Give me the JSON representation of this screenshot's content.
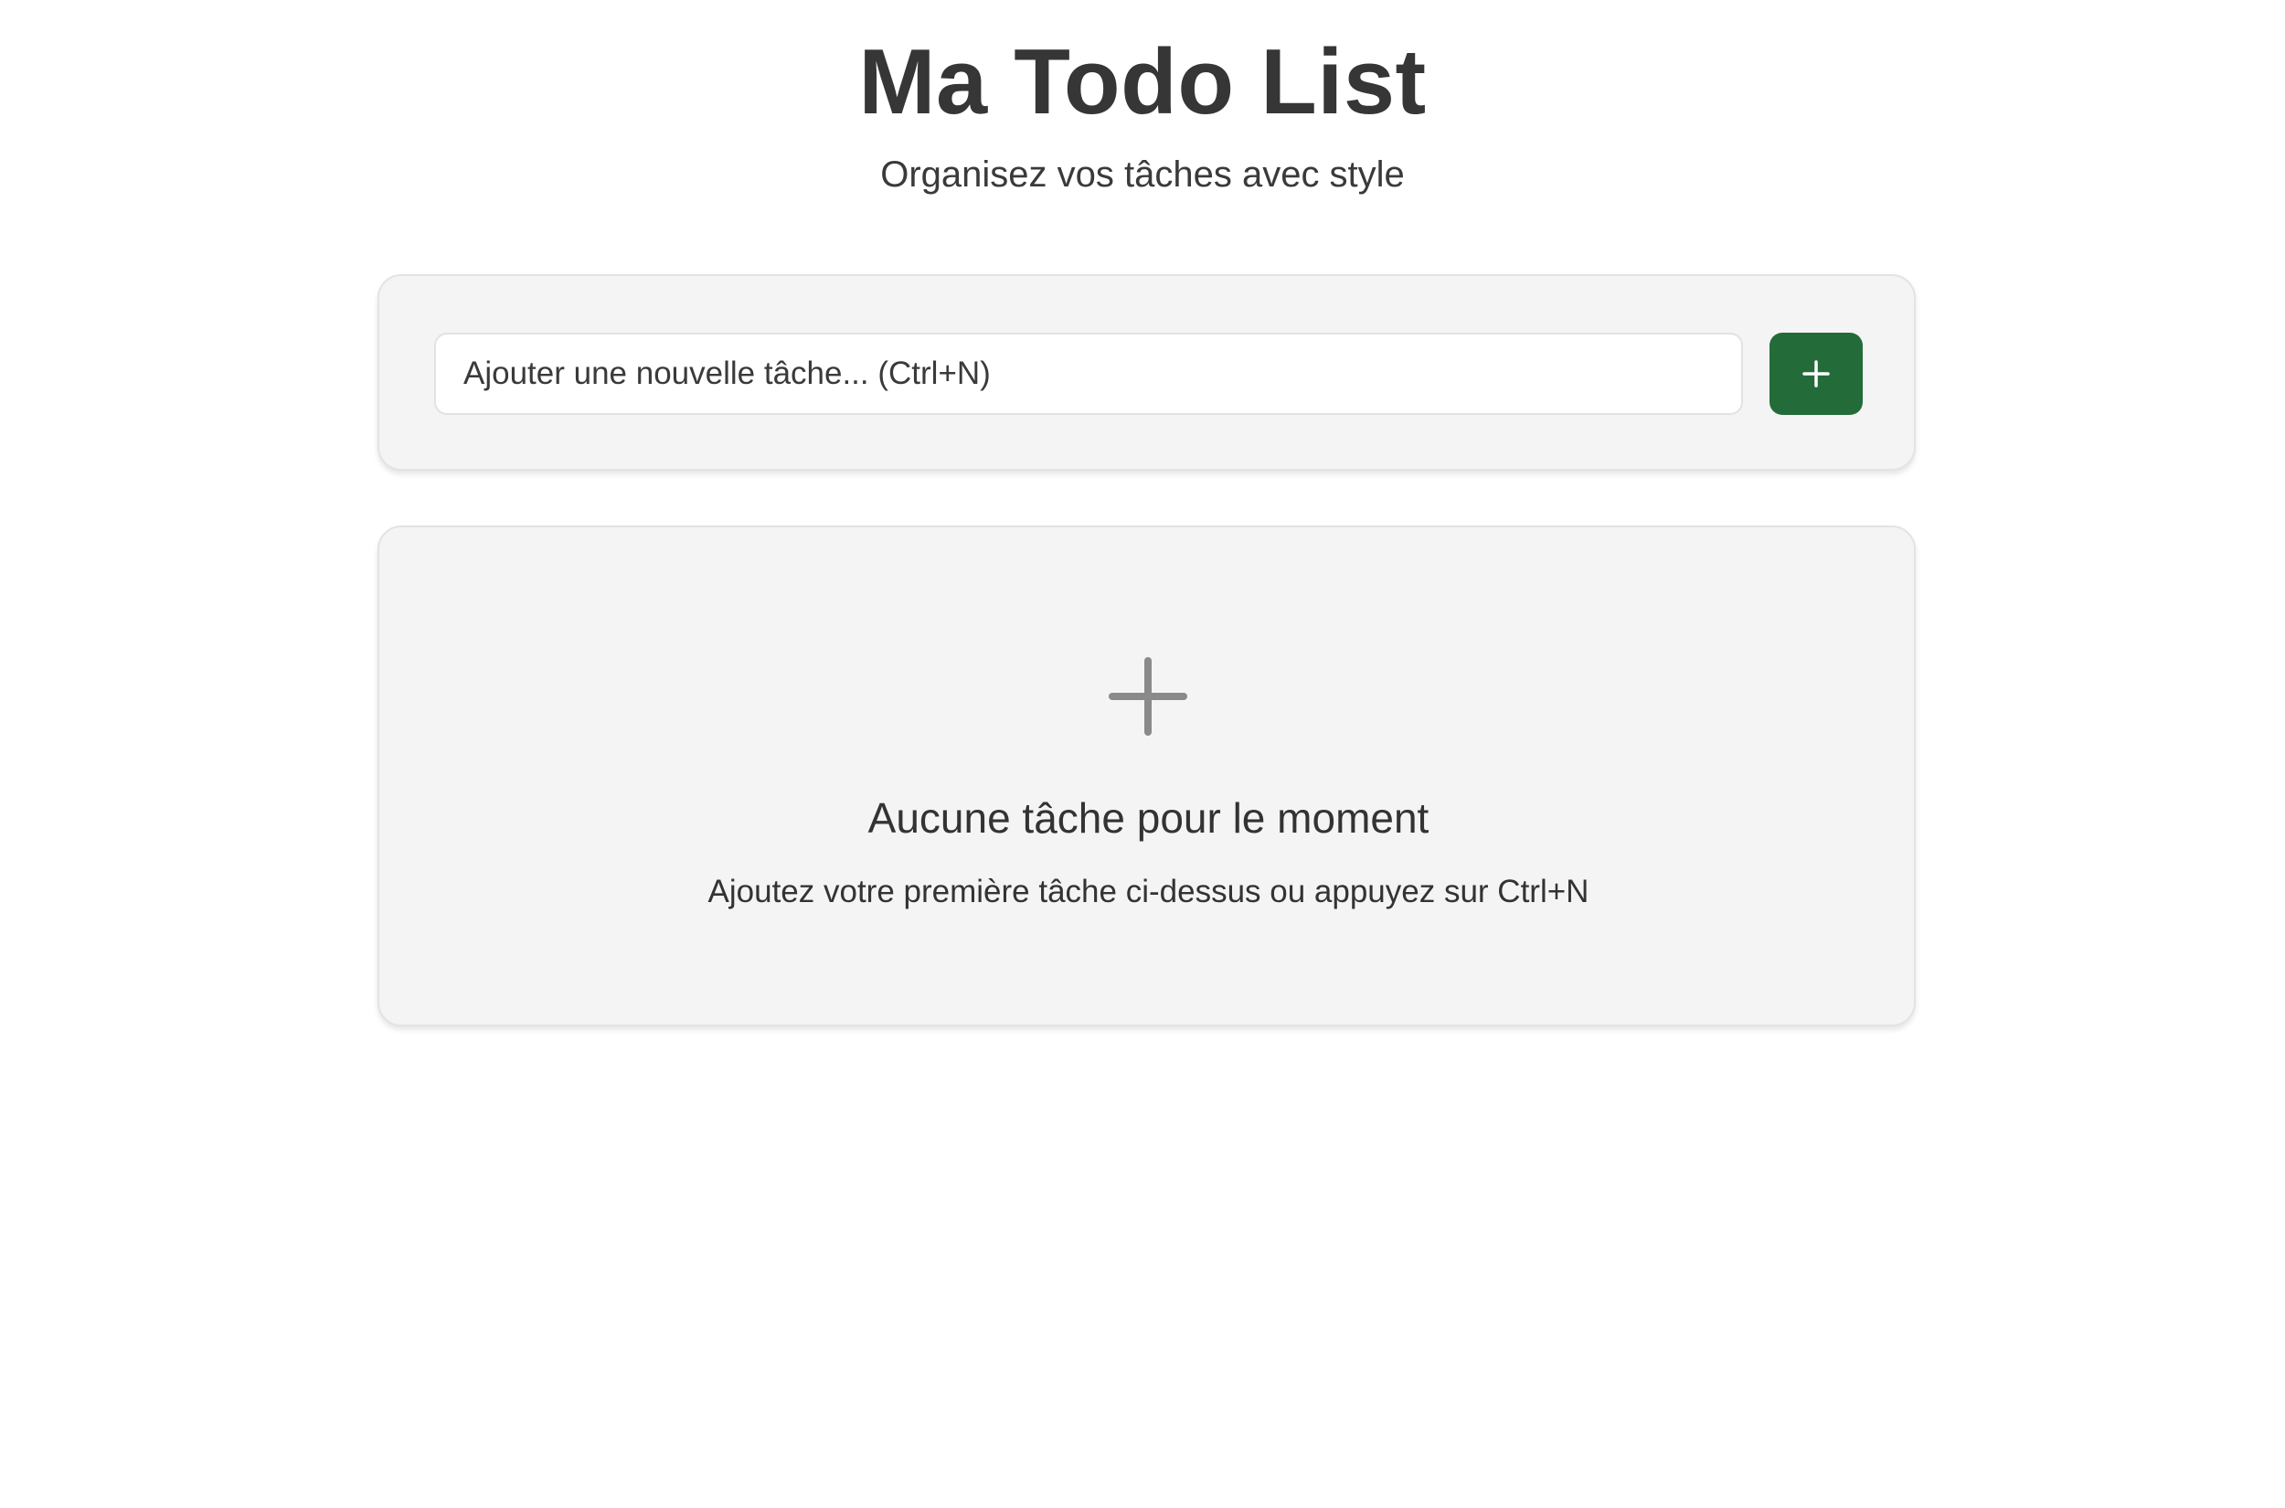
{
  "header": {
    "title": "Ma Todo List",
    "subtitle": "Organisez vos tâches avec style"
  },
  "add_task": {
    "placeholder": "Ajouter une nouvelle tâche... (Ctrl+N)",
    "value": "",
    "button_icon": "plus-icon",
    "button_color": "#246b3a"
  },
  "empty_state": {
    "icon": "plus-icon",
    "title": "Aucune tâche pour le moment",
    "hint": "Ajoutez votre première tâche ci-dessus ou appuyez sur Ctrl+N"
  }
}
